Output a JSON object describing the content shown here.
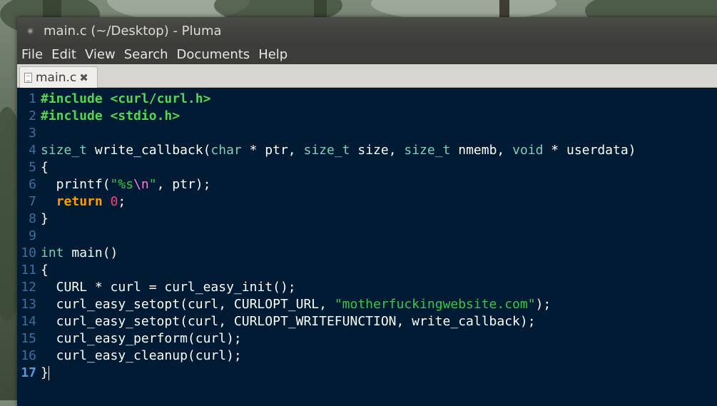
{
  "window": {
    "title": "main.c (~/Desktop) - Pluma"
  },
  "menu": [
    "File",
    "Edit",
    "View",
    "Search",
    "Documents",
    "Help"
  ],
  "tab": {
    "label": "main.c",
    "close": "✖"
  },
  "editor": {
    "current_line": 17,
    "line_numbers": [
      "1",
      "2",
      "3",
      "4",
      "5",
      "6",
      "7",
      "8",
      "9",
      "10",
      "11",
      "12",
      "13",
      "14",
      "15",
      "16",
      "17"
    ],
    "lines": [
      [
        {
          "t": "#include",
          "c": "pp"
        },
        {
          "t": " "
        },
        {
          "t": "<curl/curl.h>",
          "c": "inc"
        }
      ],
      [
        {
          "t": "#include",
          "c": "pp"
        },
        {
          "t": " "
        },
        {
          "t": "<stdio.h>",
          "c": "inc"
        }
      ],
      [],
      [
        {
          "t": "size_t",
          "c": "ty"
        },
        {
          "t": " write_callback("
        },
        {
          "t": "char",
          "c": "ty"
        },
        {
          "t": " * ptr, "
        },
        {
          "t": "size_t",
          "c": "ty"
        },
        {
          "t": " size, "
        },
        {
          "t": "size_t",
          "c": "ty"
        },
        {
          "t": " nmemb, "
        },
        {
          "t": "void",
          "c": "ty"
        },
        {
          "t": " * userdata)"
        }
      ],
      [
        {
          "t": "{"
        }
      ],
      [
        {
          "t": "  printf("
        },
        {
          "t": "\"%s",
          "c": "str"
        },
        {
          "t": "\\n",
          "c": "esc"
        },
        {
          "t": "\"",
          "c": "str"
        },
        {
          "t": ", ptr);"
        }
      ],
      [
        {
          "t": "  "
        },
        {
          "t": "return",
          "c": "kw"
        },
        {
          "t": " "
        },
        {
          "t": "0",
          "c": "num"
        },
        {
          "t": ";"
        }
      ],
      [
        {
          "t": "}"
        }
      ],
      [],
      [
        {
          "t": "int",
          "c": "ty"
        },
        {
          "t": " main()"
        }
      ],
      [
        {
          "t": "{"
        }
      ],
      [
        {
          "t": "  CURL * curl = curl_easy_init();"
        }
      ],
      [
        {
          "t": "  curl_easy_setopt(curl, CURLOPT_URL, "
        },
        {
          "t": "\"motherfuckingwebsite.com\"",
          "c": "str"
        },
        {
          "t": ");"
        }
      ],
      [
        {
          "t": "  curl_easy_setopt(curl, CURLOPT_WRITEFUNCTION, write_callback);"
        }
      ],
      [
        {
          "t": "  curl_easy_perform(curl);"
        }
      ],
      [
        {
          "t": "  curl_easy_cleanup(curl);"
        }
      ],
      [
        {
          "t": "}"
        }
      ]
    ]
  }
}
